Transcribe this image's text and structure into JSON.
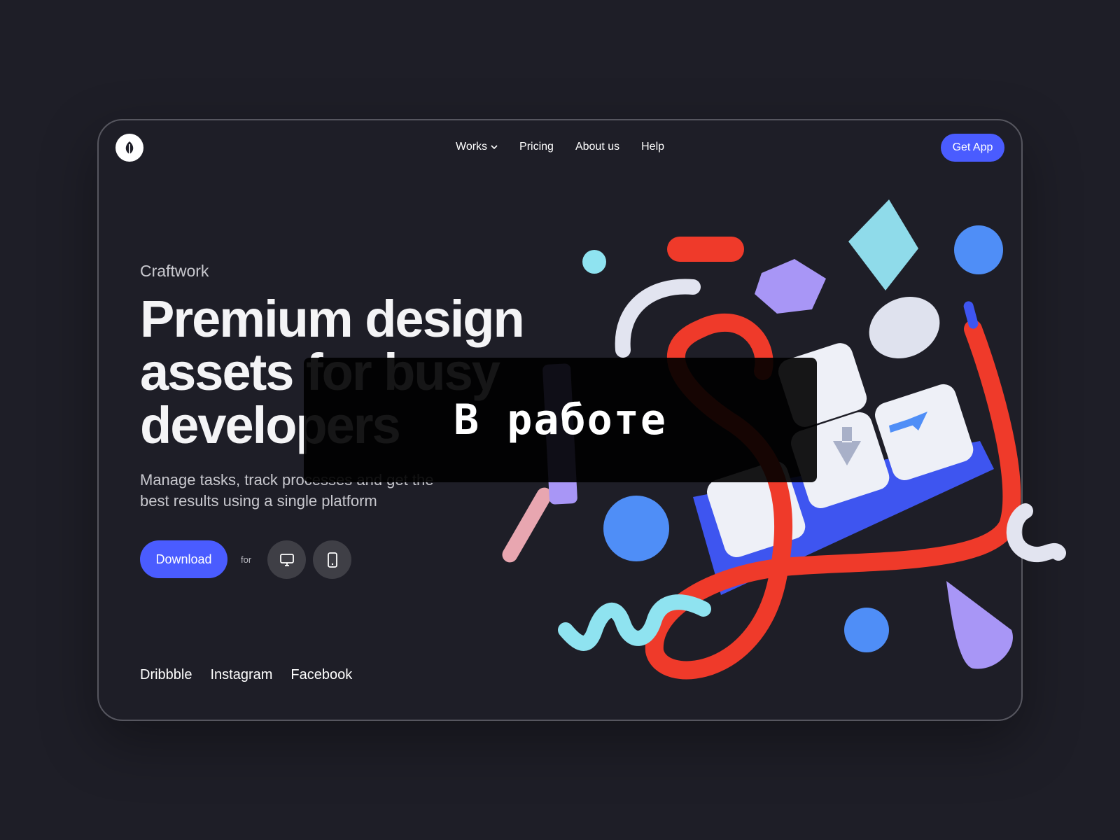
{
  "nav": {
    "items": [
      {
        "label": "Works"
      },
      {
        "label": "Pricing"
      },
      {
        "label": "About us"
      },
      {
        "label": "Help"
      }
    ],
    "cta": "Get App"
  },
  "hero": {
    "brand": "Craftwork",
    "headline_line1": "Premium design",
    "headline_line2": "assets for busy",
    "headline_line3": "developers",
    "subtitle": "Manage tasks, track processes and get the best results using a single platform",
    "download_label": "Download",
    "for_label": "for",
    "platforms": [
      {
        "icon": "desktop-icon"
      },
      {
        "icon": "mobile-icon"
      }
    ]
  },
  "socials": [
    "Dribbble",
    "Instagram",
    "Facebook"
  ],
  "overlay": {
    "text": "В работе"
  },
  "colors": {
    "background": "#1e1e27",
    "accent": "#4a5cff",
    "text": "#f4f4f6",
    "muted": "#c8c8ce",
    "red": "#ef3a2a",
    "blue": "#4f8ef7",
    "lilac": "#a896f6",
    "cyan": "#8fe3f0"
  }
}
